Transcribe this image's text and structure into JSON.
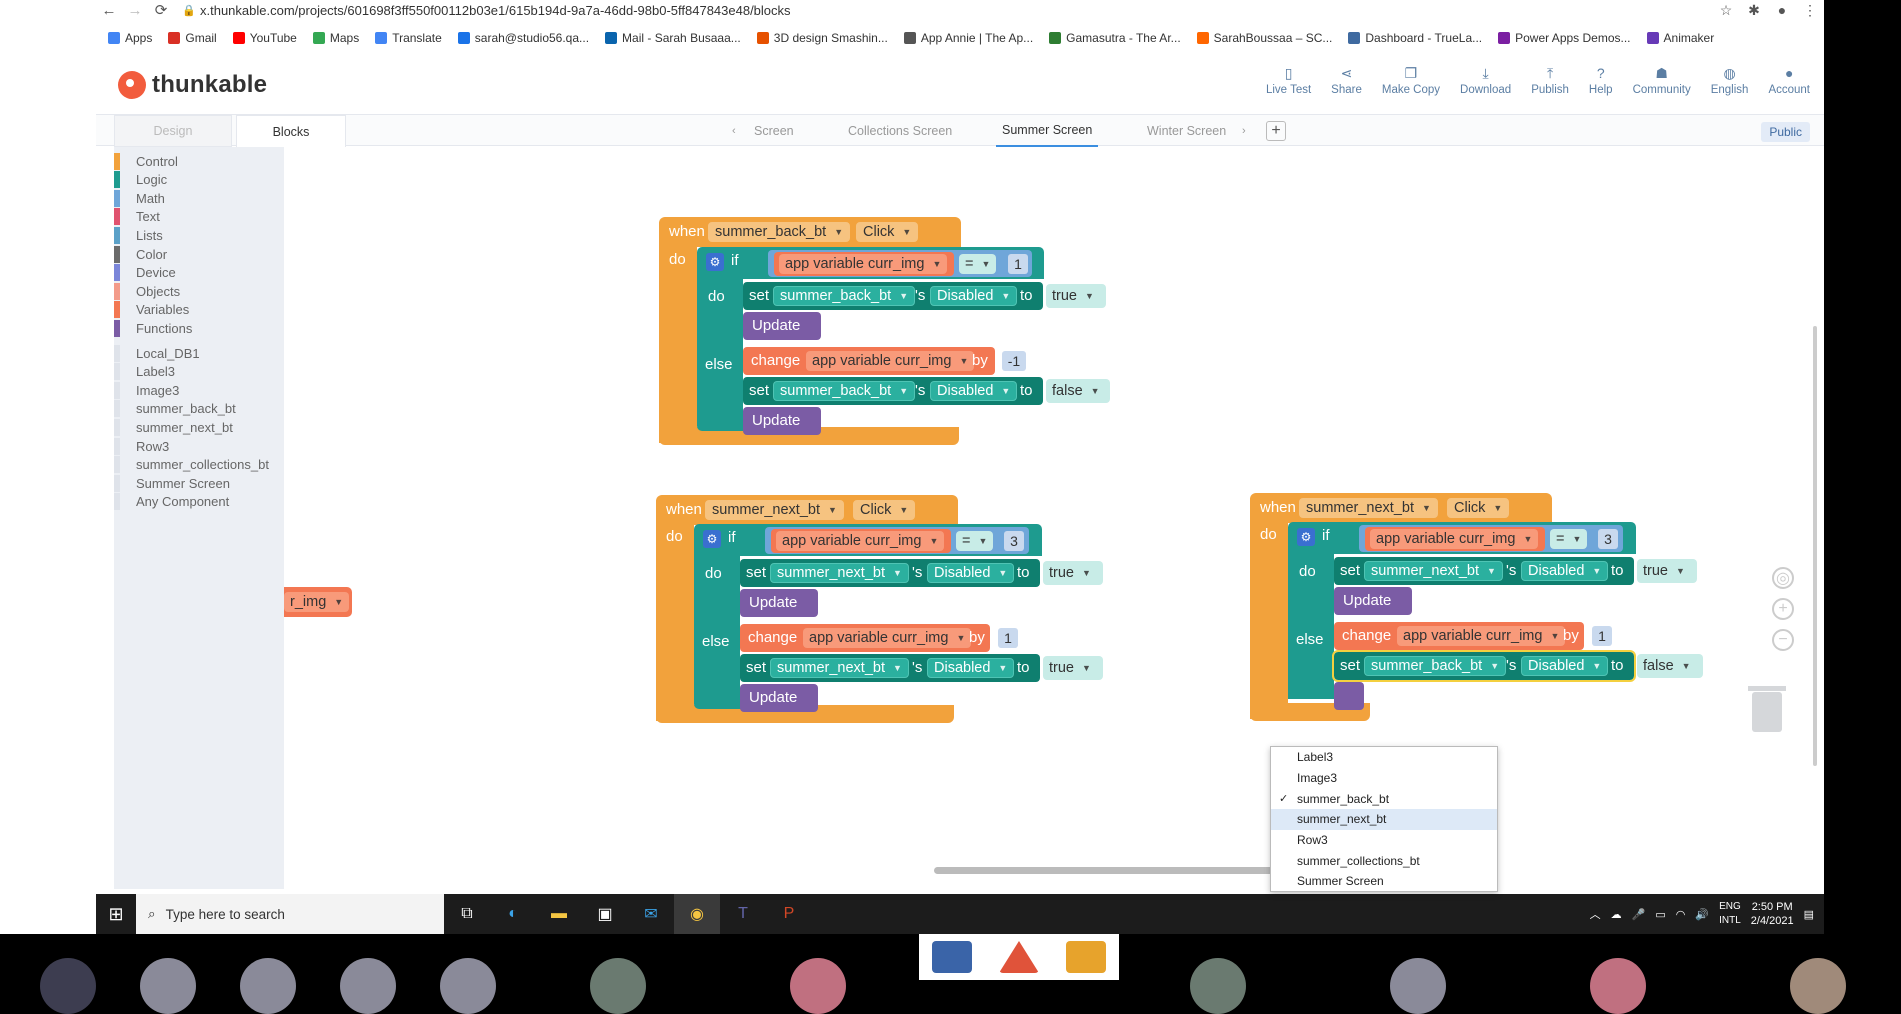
{
  "browser": {
    "url": "x.thunkable.com/projects/601698f3ff550f00112b03e1/615b194d-9a7a-46dd-98b0-5ff847843e48/blocks",
    "bookmarks": [
      {
        "label": "Apps",
        "color": "#4285f4"
      },
      {
        "label": "Gmail",
        "color": "#d93025"
      },
      {
        "label": "YouTube",
        "color": "#ff0000"
      },
      {
        "label": "Maps",
        "color": "#34a853"
      },
      {
        "label": "Translate",
        "color": "#4285f4"
      },
      {
        "label": "sarah@studio56.qa...",
        "color": "#1a73e8"
      },
      {
        "label": "Mail - Sarah Busaaa...",
        "color": "#0a64ad"
      },
      {
        "label": "3D design Smashin...",
        "color": "#e65100"
      },
      {
        "label": "App Annie | The Ap...",
        "color": "#555555"
      },
      {
        "label": "Gamasutra - The Ar...",
        "color": "#2e7d32"
      },
      {
        "label": "SarahBoussaa – SC...",
        "color": "#ff6600"
      },
      {
        "label": "Dashboard - TrueLa...",
        "color": "#3f6aa0"
      },
      {
        "label": "Power Apps Demos...",
        "color": "#7b1fa2"
      },
      {
        "label": "Animaker",
        "color": "#673ab7"
      }
    ]
  },
  "app": {
    "brand": "thunkable",
    "nav": [
      {
        "label": "Live Test",
        "icon": "phone-icon"
      },
      {
        "label": "Share",
        "icon": "share-icon"
      },
      {
        "label": "Make Copy",
        "icon": "copy-icon"
      },
      {
        "label": "Download",
        "icon": "download-icon"
      },
      {
        "label": "Publish",
        "icon": "upload-icon"
      },
      {
        "label": "Help",
        "icon": "help-icon"
      },
      {
        "label": "Community",
        "icon": "community-icon"
      },
      {
        "label": "English",
        "icon": "globe-icon"
      },
      {
        "label": "Account",
        "icon": "avatar-icon"
      }
    ],
    "tabs": {
      "design": "Design",
      "blocks": "Blocks"
    },
    "screens": [
      "Screen",
      "Collections Screen",
      "Summer Screen",
      "Winter Screen"
    ],
    "active_screen": "Summer Screen",
    "public_label": "Public"
  },
  "toolbox": {
    "categories": [
      {
        "label": "Control",
        "color": "#f2a23c"
      },
      {
        "label": "Logic",
        "color": "#1e9b8f"
      },
      {
        "label": "Math",
        "color": "#6fa6d9"
      },
      {
        "label": "Text",
        "color": "#e0536f"
      },
      {
        "label": "Lists",
        "color": "#5ba1c8"
      },
      {
        "label": "Color",
        "color": "#6b6b6b"
      },
      {
        "label": "Device",
        "color": "#7b86d9"
      },
      {
        "label": "Objects",
        "color": "#f39b8a"
      },
      {
        "label": "Variables",
        "color": "#f37752"
      },
      {
        "label": "Functions",
        "color": "#7b5ca5"
      }
    ],
    "components": [
      "Local_DB1",
      "Label3",
      "Image3",
      "summer_back_bt",
      "summer_next_bt",
      "Row3",
      "summer_collections_bt",
      "Summer Screen",
      "Any Component"
    ]
  },
  "blocks": {
    "when": "when",
    "do": "do",
    "if": "if",
    "else": "else",
    "set": "set",
    "s": "'s",
    "to": "to",
    "update": "Update",
    "change": "change",
    "by": "by",
    "click": "Click",
    "eq": "=",
    "disabled": "Disabled",
    "var": "app variable curr_img",
    "true": "true",
    "false": "false",
    "stray": "r_img",
    "b1": {
      "comp": "summer_back_bt",
      "cmp": "1",
      "set_comp": "summer_back_bt",
      "set_val": "true",
      "chg": "-1",
      "set2_comp": "summer_back_bt",
      "set2_val": "false"
    },
    "b2": {
      "comp": "summer_next_bt",
      "cmp": "3",
      "set_comp": "summer_next_bt",
      "set_val": "true",
      "chg": "1",
      "set2_comp": "summer_next_bt",
      "set2_val": "true"
    },
    "b3": {
      "comp": "summer_next_bt",
      "cmp": "3",
      "set_comp": "summer_next_bt",
      "set_val": "true",
      "chg": "1",
      "set2_comp": "summer_back_bt",
      "set2_val": "false"
    }
  },
  "dropdown": {
    "items": [
      "Label3",
      "Image3",
      "summer_back_bt",
      "summer_next_bt",
      "Row3",
      "summer_collections_bt",
      "Summer Screen"
    ],
    "checked": "summer_back_bt",
    "highlighted": "summer_next_bt"
  },
  "taskbar": {
    "search_placeholder": "Type here to search",
    "time": "2:50 PM",
    "date": "2/4/2021",
    "lang1": "ENG",
    "lang2": "INTL"
  }
}
